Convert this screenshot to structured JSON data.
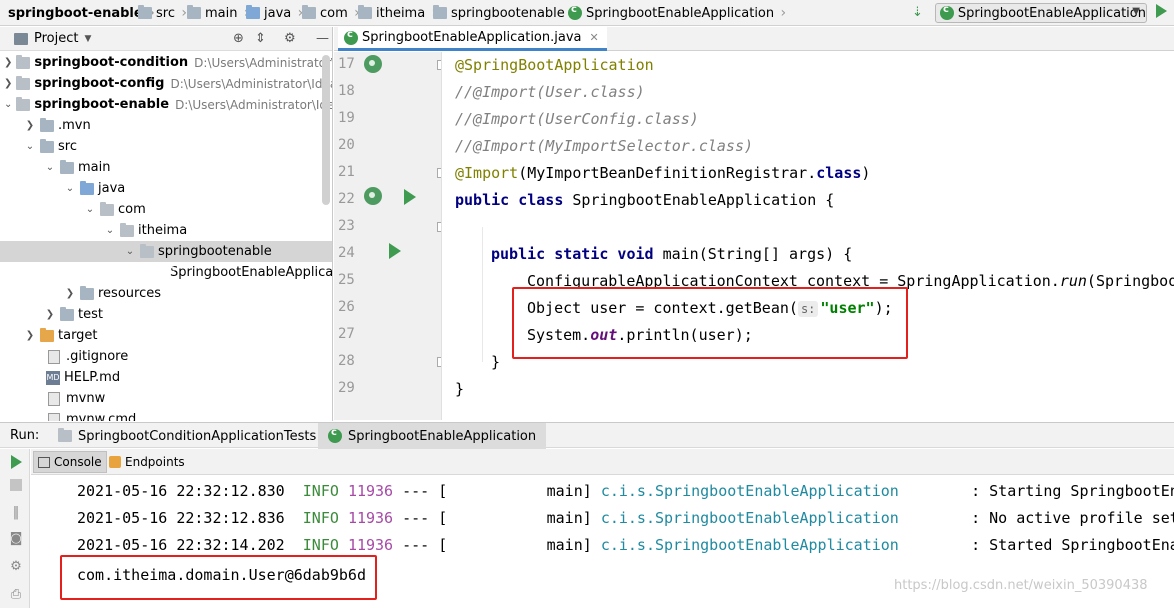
{
  "navbar": {
    "crumbs": [
      "springboot-enable",
      "src",
      "main",
      "java",
      "com",
      "itheima",
      "springbootenable",
      "SpringbootEnableApplication"
    ],
    "run_config": "SpringbootEnableApplication"
  },
  "project": {
    "title": "Project",
    "tree": [
      {
        "label": "springboot-condition",
        "path": "D:\\Users\\Administrator\\Ide"
      },
      {
        "label": "springboot-config",
        "path": "D:\\Users\\Administrator\\IdeaP"
      },
      {
        "label": "springboot-enable",
        "path": "D:\\Users\\Administrator\\IdeaP"
      },
      {
        "label": ".mvn"
      },
      {
        "label": "src"
      },
      {
        "label": "main"
      },
      {
        "label": "java"
      },
      {
        "label": "com"
      },
      {
        "label": "itheima"
      },
      {
        "label": "springbootenable"
      },
      {
        "label": "SpringbootEnableApplica"
      },
      {
        "label": "resources"
      },
      {
        "label": "test"
      },
      {
        "label": "target"
      },
      {
        "label": ".gitignore"
      },
      {
        "label": "HELP.md"
      },
      {
        "label": "mvnw"
      },
      {
        "label": "mvnw.cmd"
      }
    ]
  },
  "editor": {
    "tab": "SpringbootEnableApplication.java",
    "line_numbers": [
      "17",
      "18",
      "19",
      "20",
      "21",
      "22",
      "23",
      "24",
      "25",
      "26",
      "27",
      "28",
      "29"
    ],
    "code": {
      "l17": "@SpringBootApplication",
      "l18": "//@Import(User.class)",
      "l19": "//@Import(UserConfig.class)",
      "l20": "//@Import(MyImportSelector.class)",
      "l21_ann": "@Import",
      "l21_a": "(MyImportBeanDefinitionRegistrar.",
      "l21_kw": "class",
      "l21_b": ")",
      "l22_kw": "public class",
      "l22_rest": " SpringbootEnableApplication {",
      "l24_kw": "public static void",
      "l24_rest": " main(String[] args) {",
      "l25_a": "ConfigurableApplicationContext context = SpringApplication.",
      "l25_run": "run",
      "l25_b": "(SpringbootEnableApplication.class, args);",
      "l26_a": "Object user = context.getBean(",
      "l26_hint": "s:",
      "l26_str": "\"user\"",
      "l26_b": ");",
      "l27_a": "System.",
      "l27_out": "out",
      "l27_b": ".println(user);",
      "l28": "}",
      "l29": "}"
    }
  },
  "run": {
    "label": "Run:",
    "tabs": [
      "SpringbootConditionApplicationTests",
      "SpringbootEnableApplication"
    ],
    "subtabs": [
      "Console",
      "Endpoints"
    ],
    "logs": [
      {
        "ts": "2021-05-16 22:32:12.830",
        "level": "INFO",
        "pid": "11936",
        "sep": "--- [",
        "thread": "main]",
        "logger": "c.i.s.SpringbootEnableApplication",
        "msg": ": Starting SpringbootEnableApplication"
      },
      {
        "ts": "2021-05-16 22:32:12.836",
        "level": "INFO",
        "pid": "11936",
        "sep": "--- [",
        "thread": "main]",
        "logger": "c.i.s.SpringbootEnableApplication",
        "msg": ": No active profile set"
      },
      {
        "ts": "2021-05-16 22:32:14.202",
        "level": "INFO",
        "pid": "11936",
        "sep": "--- [",
        "thread": "main]",
        "logger": "c.i.s.SpringbootEnableApplication",
        "msg": ": Started SpringbootEnableApplication"
      }
    ],
    "output": "com.itheima.domain.User@6dab9b6d"
  },
  "watermark": "https://blog.csdn.net/weixin_50390438"
}
